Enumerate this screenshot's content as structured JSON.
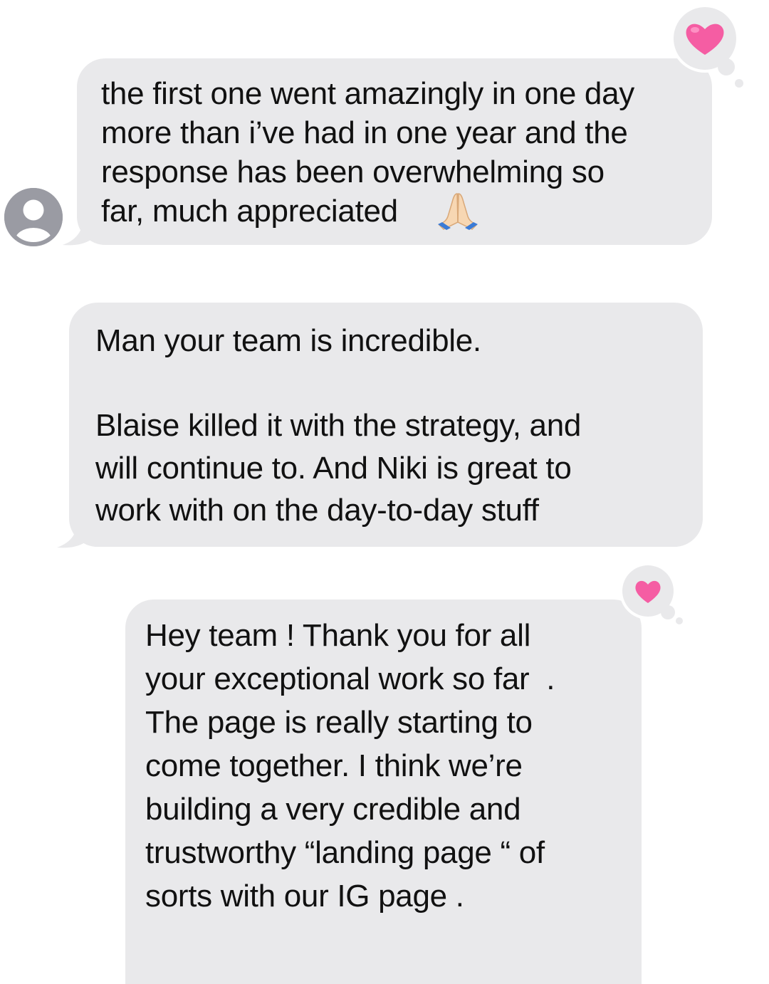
{
  "conversation": {
    "messages": [
      {
        "sender": "received",
        "text": "the first one went amazingly in one day\nmore than i’ve had in one year and the\nresponse has been overwhelming so\nfar, much appreciated",
        "emoji": "folded-hands",
        "reaction": "heart"
      },
      {
        "sender": "received",
        "text": "Man your team is incredible.\n\nBlaise killed it with the strategy, and\nwill continue to. And Niki is great to\nwork with on the day-to-day stuff"
      },
      {
        "sender": "received",
        "text": "Hey team ! Thank you for all\nyour exceptional work so far  .\nThe page is really starting to\ncome together. I think we’re\nbuilding a very credible and\ntrustworthy “landing page “ of\nsorts with our IG page .",
        "reaction": "heart"
      }
    ]
  },
  "colors": {
    "bubble_background": "#e9e9eb",
    "reaction_background": "#e9e9eb",
    "heart": "#f55da3",
    "avatar": "#9a9ba3",
    "text": "#111111"
  },
  "icons": {
    "avatar": "person-silhouette-icon",
    "reaction": "heart-icon",
    "emoji": "folded-hands-icon"
  }
}
